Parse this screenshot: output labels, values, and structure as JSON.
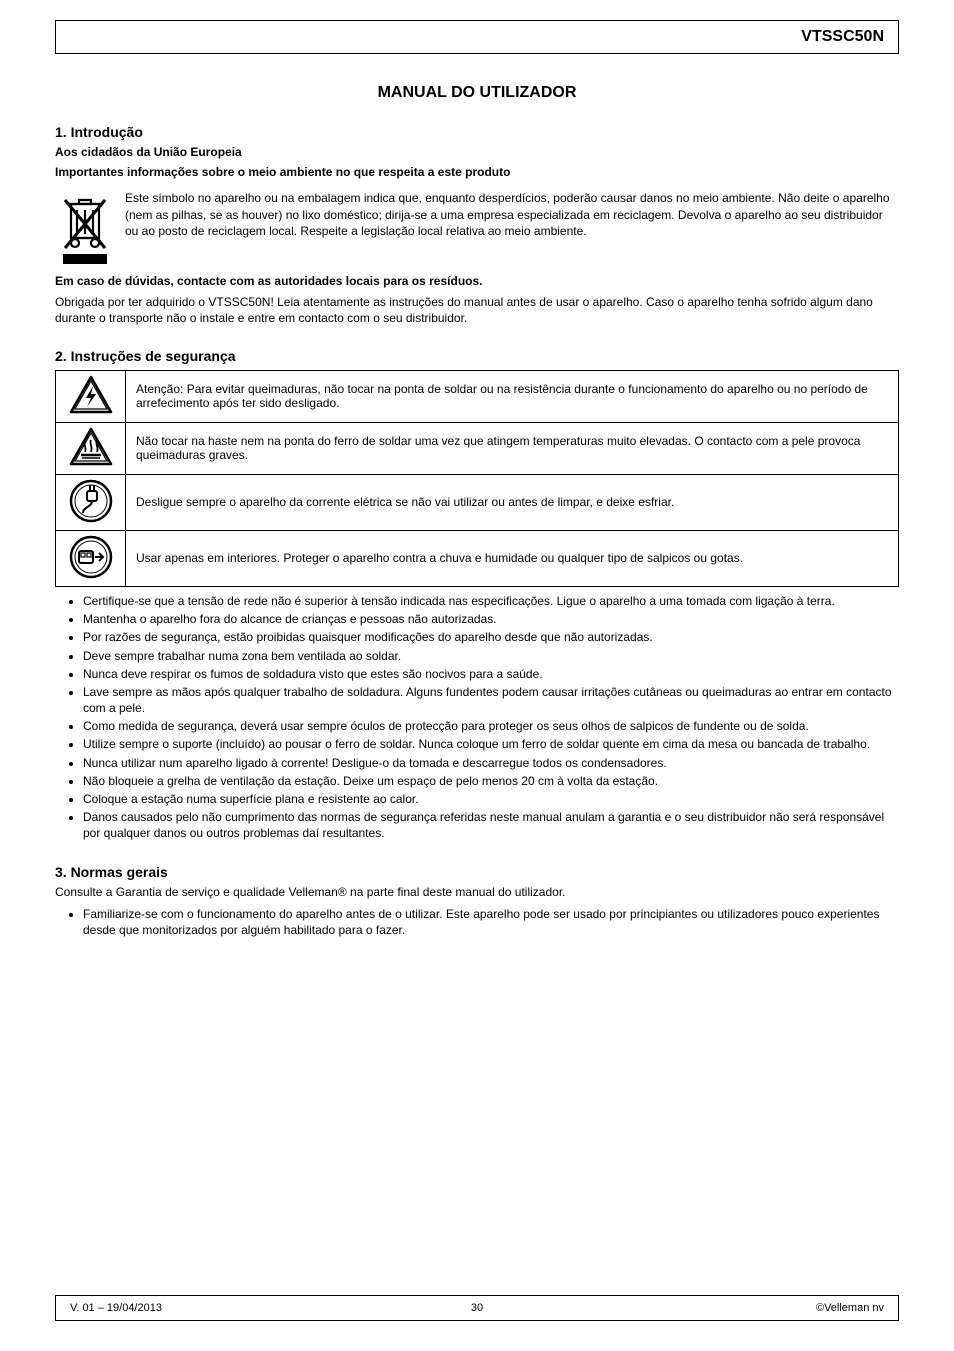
{
  "header": {
    "product": "VTSSC50N"
  },
  "footer": {
    "date": "V. 01 – 19/04/2013",
    "copyright": "©Velleman nv",
    "page": "30"
  },
  "manual_title": "MANUAL DO UTILIZADOR",
  "sections": {
    "intro": {
      "heading": "1. Introdução",
      "subheading": "Aos cidadãos da União Europeia",
      "env_notice": "Importantes informações sobre o meio ambiente no que respeita a este produto",
      "weee_p1": "Este símbolo no aparelho ou na embalagem indica que, enquanto desperdícios, poderão causar danos no meio ambiente. Não deite o aparelho (nem as pilhas, se as houver) no lixo doméstico; dirija-se a uma empresa especializada em reciclagem. Devolva o aparelho ao seu distribuidor ou ao posto de reciclagem local. Respeite a legislação local relativa ao meio ambiente.",
      "weee_p2": "Em caso de dúvidas, contacte com as autoridades locais para os resíduos.",
      "thanks": "Obrigada por ter adquirido o VTSSC50N! Leia atentamente as instruções do manual antes de usar o aparelho. Caso o aparelho tenha sofrido algum dano durante o transporte não o instale e entre em contacto com o seu distribuidor."
    },
    "safety": {
      "heading": "2. Instruções de segurança",
      "rows": [
        {
          "icon": "caution-electric",
          "text": "Atenção: Para evitar queimaduras, não tocar na ponta de soldar ou na resistência durante o funcionamento do aparelho ou no período de arrefecimento após ter sido desligado."
        },
        {
          "icon": "caution-hot",
          "text": "Não tocar na haste nem na ponta do ferro de soldar uma vez que atingem temperaturas muito elevadas. O contacto com a pele provoca queimaduras graves."
        },
        {
          "icon": "unplug",
          "text": "Desligue sempre o aparelho da corrente elétrica se não vai utilizar ou antes de limpar, e deixe esfriar."
        },
        {
          "icon": "indoor",
          "text": "Usar apenas em interiores. Proteger o aparelho contra a chuva e humidade ou qualquer tipo de salpicos ou gotas."
        }
      ],
      "bullets": [
        "Certifique-se que a tensão de rede não é superior à tensão indicada nas especificações. Ligue o aparelho a uma tomada com ligação à terra.",
        "Mantenha o aparelho fora do alcance de crianças e pessoas não autorizadas.",
        "Por razões de segurança, estão proibidas quaisquer modificações do aparelho desde que não autorizadas.",
        "Deve sempre trabalhar numa zona bem ventilada ao soldar.",
        "Nunca deve respirar os fumos de soldadura visto que estes são nocivos para a saúde.",
        "Lave sempre as mãos após qualquer trabalho de soldadura. Alguns fundentes podem causar irritações cutâneas ou queimaduras ao entrar em contacto com a pele.",
        "Como medida de segurança, deverá usar sempre óculos de protecção para proteger os seus olhos de salpicos de fundente ou de solda.",
        "Utilize sempre o suporte (incluído) ao pousar o ferro de soldar. Nunca coloque um ferro de soldar quente em cima da mesa ou bancada de trabalho.",
        "Nunca utilizar num aparelho ligado à corrente! Desligue-o da tomada e descarregue todos os condensadores.",
        "Não bloqueie a grelha de ventilação da estação. Deixe um espaço de pelo menos 20 cm à volta da estação.",
        "Coloque a estação numa superfície plana e resistente ao calor.",
        "Danos causados pelo não cumprimento das normas de segurança referidas neste manual anulam a garantia e o seu distribuidor não será responsável por qualquer danos ou outros problemas daí resultantes."
      ]
    },
    "general": {
      "heading": "3. Normas gerais",
      "ref": "Consulte a Garantia de serviço e qualidade Velleman® na parte final deste manual do utilizador.",
      "bullets": [
        "Familiarize-se com o funcionamento do aparelho antes de o utilizar. Este aparelho pode ser usado por principiantes ou utilizadores pouco experientes desde que monitorizados por alguém habilitado para o fazer."
      ]
    }
  },
  "icons": {
    "weee": "weee-bin-icon",
    "caution-electric": "caution-electric-icon",
    "caution-hot": "caution-hot-surface-icon",
    "unplug": "unplug-icon",
    "indoor": "indoor-use-icon"
  }
}
